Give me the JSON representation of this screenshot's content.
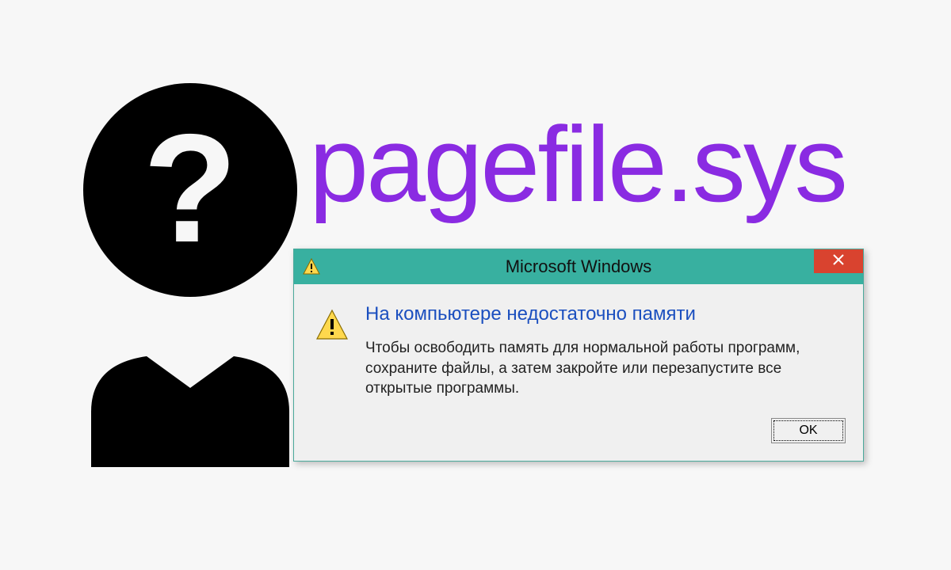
{
  "headline": {
    "text": "pagefile.sys",
    "color": "#8a2be2"
  },
  "person_icon": "question-person-icon",
  "dialog": {
    "title": "Microsoft Windows",
    "close_label": "Close",
    "warning_icon": "warning-triangle-icon",
    "heading": "На компьютере недостаточно памяти",
    "message": "Чтобы освободить память для нормальной работы программ, сохраните файлы, а затем закройте или перезапустите все открытые программы.",
    "ok_label": "OK",
    "colors": {
      "titlebar": "#38b0a0",
      "close": "#d9432f",
      "heading": "#1b4fbf"
    }
  }
}
